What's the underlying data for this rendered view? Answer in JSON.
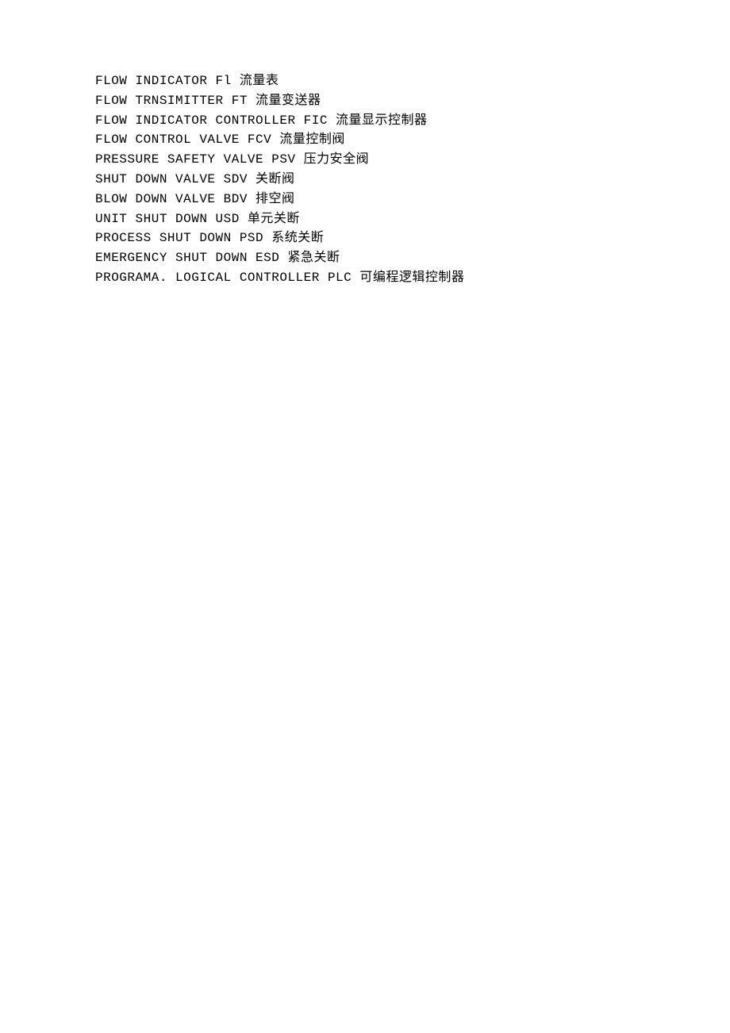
{
  "lines": [
    "FLOW INDICATOR Fl 流量表",
    "FLOW TRNSIMITTER FT 流量变送器",
    "FLOW INDICATOR CONTROLLER FIC 流量显示控制器",
    "FLOW CONTROL VALVE FCV 流量控制阀",
    "PRESSURE SAFETY VALVE PSV 压力安全阀",
    "SHUT DOWN VALVE SDV 关断阀",
    "BLOW DOWN VALVE BDV 排空阀",
    "UNIT SHUT DOWN USD 单元关断",
    "PROCESS SHUT DOWN PSD 系统关断",
    "EMERGENCY SHUT DOWN ESD 紧急关断",
    "PROGRAMA. LOGICAL CONTROLLER PLC 可编程逻辑控制器"
  ]
}
